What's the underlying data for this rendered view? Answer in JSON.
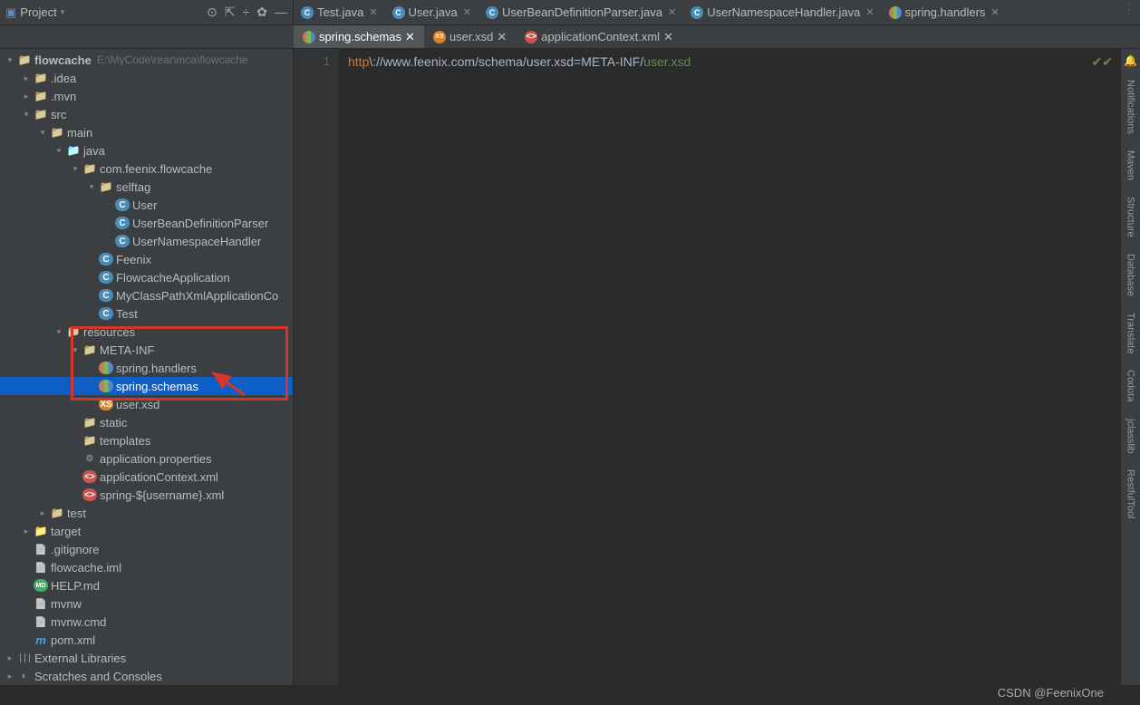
{
  "header": {
    "project_label": "Project",
    "toolbar": [
      "⊕",
      "⊼",
      "÷",
      "☆",
      "—"
    ]
  },
  "editor_tabs": [
    {
      "icon": "java",
      "label": "Test.java"
    },
    {
      "icon": "java",
      "label": "User.java"
    },
    {
      "icon": "java",
      "label": "UserBeanDefinitionParser.java"
    },
    {
      "icon": "java",
      "label": "UserNamespaceHandler.java"
    },
    {
      "icon": "bars",
      "label": "spring.handlers"
    }
  ],
  "secondary_tabs": [
    {
      "icon": "bars",
      "label": "spring.schemas",
      "active": true
    },
    {
      "icon": "xsd",
      "label": "user.xsd",
      "active": false
    },
    {
      "icon": "xml",
      "label": "applicationContext.xml",
      "active": false
    }
  ],
  "tree": [
    {
      "d": 0,
      "ch": "open",
      "icon": "folder",
      "text": "flowcache",
      "extra": "E:\\MyCode\\rear\\mca\\flowcache",
      "bold": true
    },
    {
      "d": 1,
      "ch": "closed",
      "icon": "folder",
      "text": ".idea"
    },
    {
      "d": 1,
      "ch": "closed",
      "icon": "folder",
      "text": ".mvn"
    },
    {
      "d": 1,
      "ch": "open",
      "icon": "folder",
      "text": "src"
    },
    {
      "d": 2,
      "ch": "open",
      "icon": "folder",
      "text": "main"
    },
    {
      "d": 3,
      "ch": "open",
      "icon": "folder",
      "text": "java",
      "blue": true
    },
    {
      "d": 4,
      "ch": "open",
      "icon": "folder",
      "text": "com.feenix.flowcache"
    },
    {
      "d": 5,
      "ch": "open",
      "icon": "folder",
      "text": "selftag"
    },
    {
      "d": 6,
      "ch": "none",
      "icon": "java",
      "text": "User"
    },
    {
      "d": 6,
      "ch": "none",
      "icon": "java",
      "text": "UserBeanDefinitionParser"
    },
    {
      "d": 6,
      "ch": "none",
      "icon": "java",
      "text": "UserNamespaceHandler"
    },
    {
      "d": 5,
      "ch": "none",
      "icon": "java",
      "text": "Feenix"
    },
    {
      "d": 5,
      "ch": "none",
      "icon": "java",
      "text": "FlowcacheApplication"
    },
    {
      "d": 5,
      "ch": "none",
      "icon": "java",
      "text": "MyClassPathXmlApplicationCo"
    },
    {
      "d": 5,
      "ch": "none",
      "icon": "java",
      "text": "Test"
    },
    {
      "d": 3,
      "ch": "open",
      "icon": "folder",
      "text": "resources"
    },
    {
      "d": 4,
      "ch": "open",
      "icon": "folder",
      "text": "META-INF"
    },
    {
      "d": 5,
      "ch": "none",
      "icon": "bars",
      "text": "spring.handlers"
    },
    {
      "d": 5,
      "ch": "none",
      "icon": "bars",
      "text": "spring.schemas",
      "selected": true
    },
    {
      "d": 5,
      "ch": "none",
      "icon": "xsd",
      "text": "user.xsd"
    },
    {
      "d": 4,
      "ch": "none",
      "icon": "folder",
      "text": "static"
    },
    {
      "d": 4,
      "ch": "none",
      "icon": "folder",
      "text": "templates"
    },
    {
      "d": 4,
      "ch": "none",
      "icon": "props",
      "text": "application.properties"
    },
    {
      "d": 4,
      "ch": "none",
      "icon": "xml",
      "text": "applicationContext.xml"
    },
    {
      "d": 4,
      "ch": "none",
      "icon": "xml",
      "text": "spring-${username}.xml"
    },
    {
      "d": 2,
      "ch": "closed",
      "icon": "folder",
      "text": "test"
    },
    {
      "d": 1,
      "ch": "closed",
      "icon": "folder",
      "text": "target",
      "orange": true
    },
    {
      "d": 1,
      "ch": "none",
      "icon": "file",
      "text": ".gitignore"
    },
    {
      "d": 1,
      "ch": "none",
      "icon": "file",
      "text": "flowcache.iml"
    },
    {
      "d": 1,
      "ch": "none",
      "icon": "md",
      "text": "HELP.md"
    },
    {
      "d": 1,
      "ch": "none",
      "icon": "file",
      "text": "mvnw"
    },
    {
      "d": 1,
      "ch": "none",
      "icon": "file",
      "text": "mvnw.cmd"
    },
    {
      "d": 1,
      "ch": "none",
      "icon": "maven",
      "text": "pom.xml"
    },
    {
      "d": 0,
      "ch": "closed",
      "icon": "libs",
      "text": "External Libraries"
    },
    {
      "d": 0,
      "ch": "closed",
      "icon": "scratch",
      "text": "Scratches and Consoles"
    }
  ],
  "editor": {
    "line_no": "1",
    "code_kw": "http",
    "code_mid": "\\://www.feenix.com/schema/user.xsd",
    "code_eq": "=",
    "code_val1": "META-INF/",
    "code_val2": "user.xsd"
  },
  "right_tools": [
    "Notifications",
    "Maven",
    "Structure",
    "Database",
    "Translate",
    "Codota",
    "jclasslib",
    "RestfulTool"
  ],
  "watermark": "CSDN @FeenixOne"
}
